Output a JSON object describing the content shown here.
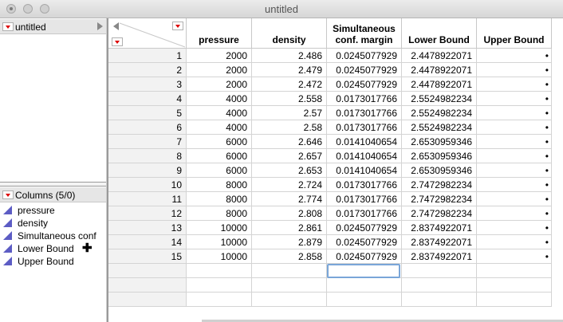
{
  "window": {
    "title": "untitled"
  },
  "left_panel": {
    "table_name": "untitled",
    "columns_header": "Columns (5/0)",
    "columns": [
      {
        "label": "pressure"
      },
      {
        "label": "density"
      },
      {
        "label": "Simultaneous conf"
      },
      {
        "label": "Lower Bound"
      },
      {
        "label": "Upper Bound"
      }
    ]
  },
  "grid": {
    "headers": [
      "pressure",
      "density",
      "Simultaneous conf. margin",
      "Lower Bound",
      "Upper Bound"
    ],
    "rows": [
      [
        "1",
        "2000",
        "2.486",
        "0.0245077929",
        "2.4478922071",
        "•"
      ],
      [
        "2",
        "2000",
        "2.479",
        "0.0245077929",
        "2.4478922071",
        "•"
      ],
      [
        "3",
        "2000",
        "2.472",
        "0.0245077929",
        "2.4478922071",
        "•"
      ],
      [
        "4",
        "4000",
        "2.558",
        "0.0173017766",
        "2.5524982234",
        "•"
      ],
      [
        "5",
        "4000",
        "2.57",
        "0.0173017766",
        "2.5524982234",
        "•"
      ],
      [
        "6",
        "4000",
        "2.58",
        "0.0173017766",
        "2.5524982234",
        "•"
      ],
      [
        "7",
        "6000",
        "2.646",
        "0.0141040654",
        "2.6530959346",
        "•"
      ],
      [
        "8",
        "6000",
        "2.657",
        "0.0141040654",
        "2.6530959346",
        "•"
      ],
      [
        "9",
        "6000",
        "2.653",
        "0.0141040654",
        "2.6530959346",
        "•"
      ],
      [
        "10",
        "8000",
        "2.724",
        "0.0173017766",
        "2.7472982234",
        "•"
      ],
      [
        "11",
        "8000",
        "2.774",
        "0.0173017766",
        "2.7472982234",
        "•"
      ],
      [
        "12",
        "8000",
        "2.808",
        "0.0173017766",
        "2.7472982234",
        "•"
      ],
      [
        "13",
        "10000",
        "2.861",
        "0.0245077929",
        "2.8374922071",
        "•"
      ],
      [
        "14",
        "10000",
        "2.879",
        "0.0245077929",
        "2.8374922071",
        "•"
      ],
      [
        "15",
        "10000",
        "2.858",
        "0.0245077929",
        "2.8374922071",
        "•"
      ]
    ]
  },
  "icons": {
    "window_controls": [
      "close-icon",
      "minimize-icon",
      "zoom-icon"
    ],
    "menu": "red-triangle-menu-icon",
    "column_type": "continuous-column-icon"
  },
  "colors": {
    "menu_triangle": "#dd0000",
    "column_icon": "#5c5cc4"
  }
}
